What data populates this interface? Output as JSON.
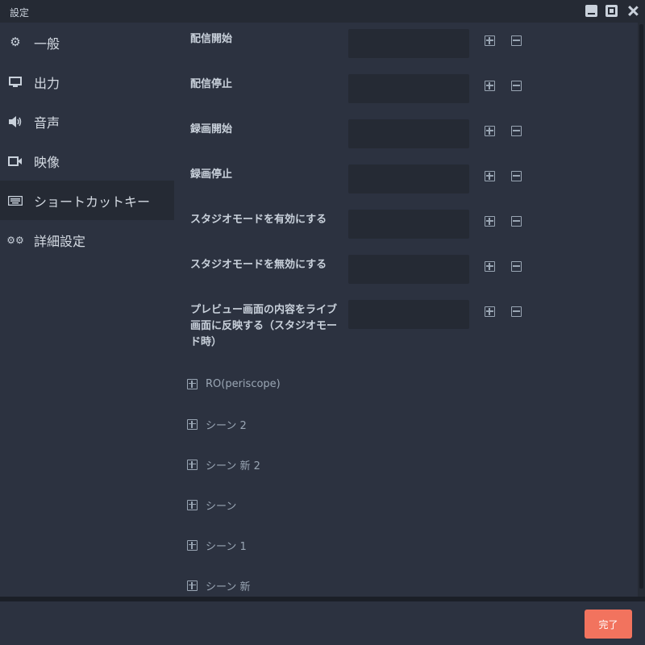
{
  "window": {
    "title": "設定"
  },
  "sidebar": {
    "items": [
      {
        "label": "一般",
        "icon": "gear-icon"
      },
      {
        "label": "出力",
        "icon": "monitor-icon"
      },
      {
        "label": "音声",
        "icon": "speaker-icon"
      },
      {
        "label": "映像",
        "icon": "camera-icon"
      },
      {
        "label": "ショートカットキー",
        "icon": "keyboard-icon"
      },
      {
        "label": "詳細設定",
        "icon": "gears-icon"
      }
    ],
    "active_index": 4
  },
  "hotkeys": [
    {
      "label": "配信開始",
      "value": ""
    },
    {
      "label": "配信停止",
      "value": ""
    },
    {
      "label": "録画開始",
      "value": ""
    },
    {
      "label": "録画停止",
      "value": ""
    },
    {
      "label": "スタジオモードを有効にする",
      "value": ""
    },
    {
      "label": "スタジオモードを無効にする",
      "value": ""
    },
    {
      "label": "プレビュー画面の内容をライブ画面に反映する（スタジオモード時）",
      "value": ""
    }
  ],
  "groups": [
    {
      "label": "RO(periscope)"
    },
    {
      "label": "シーン 2"
    },
    {
      "label": "シーン 新 2"
    },
    {
      "label": "シーン"
    },
    {
      "label": "シーン 1"
    },
    {
      "label": "シーン 新"
    }
  ],
  "footer": {
    "done_label": "完了"
  },
  "colors": {
    "accent": "#f2735e",
    "background": "#2c3240",
    "panel": "#252a34"
  }
}
